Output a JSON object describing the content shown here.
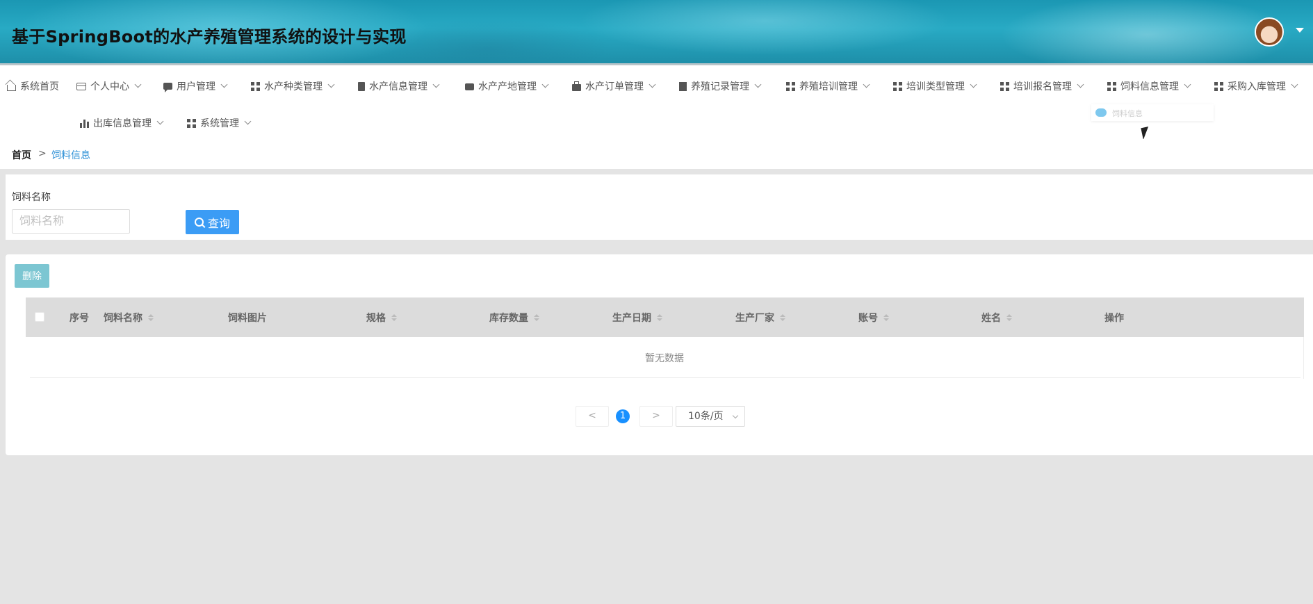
{
  "app": {
    "title": "基于SpringBoot的水产养殖管理系统的设计与实现"
  },
  "nav": {
    "items": [
      {
        "label": "系统首页",
        "icon": "home-icon"
      },
      {
        "label": "个人中心",
        "icon": "card-icon"
      },
      {
        "label": "用户管理",
        "icon": "chat-icon"
      },
      {
        "label": "水产种类管理",
        "icon": "grid-icon"
      },
      {
        "label": "水产信息管理",
        "icon": "clipboard-icon"
      },
      {
        "label": "水产产地管理",
        "icon": "wallet-icon"
      },
      {
        "label": "水产订单管理",
        "icon": "briefcase-icon"
      },
      {
        "label": "养殖记录管理",
        "icon": "book-icon"
      },
      {
        "label": "养殖培训管理",
        "icon": "grid-icon"
      },
      {
        "label": "培训类型管理",
        "icon": "grid-icon"
      },
      {
        "label": "培训报名管理",
        "icon": "grid-icon"
      },
      {
        "label": "饲料信息管理",
        "icon": "grid-icon"
      },
      {
        "label": "采购入库管理",
        "icon": "grid-icon"
      },
      {
        "label": "出库信息管理",
        "icon": "bar-chart-icon"
      },
      {
        "label": "系统管理",
        "icon": "grid-icon"
      }
    ],
    "tooltip_text": "饲料信息"
  },
  "breadcrumb": {
    "home": "首页",
    "separator": ">",
    "current": "饲料信息"
  },
  "search": {
    "label": "饲料名称",
    "placeholder": "饲料名称",
    "value": "",
    "query_button": "查询"
  },
  "table": {
    "delete_button": "删除",
    "columns": [
      "序号",
      "饲料名称",
      "饲料图片",
      "规格",
      "库存数量",
      "生产日期",
      "生产厂家",
      "账号",
      "姓名",
      "操作"
    ],
    "empty_text": "暂无数据"
  },
  "pagination": {
    "prev": "<",
    "current_page": "1",
    "next": ">",
    "page_size": "10条/页"
  },
  "colors": {
    "primary": "#3b9cf5",
    "delete": "#7cc6d2",
    "active_breadcrumb": "#2b8fd6"
  }
}
